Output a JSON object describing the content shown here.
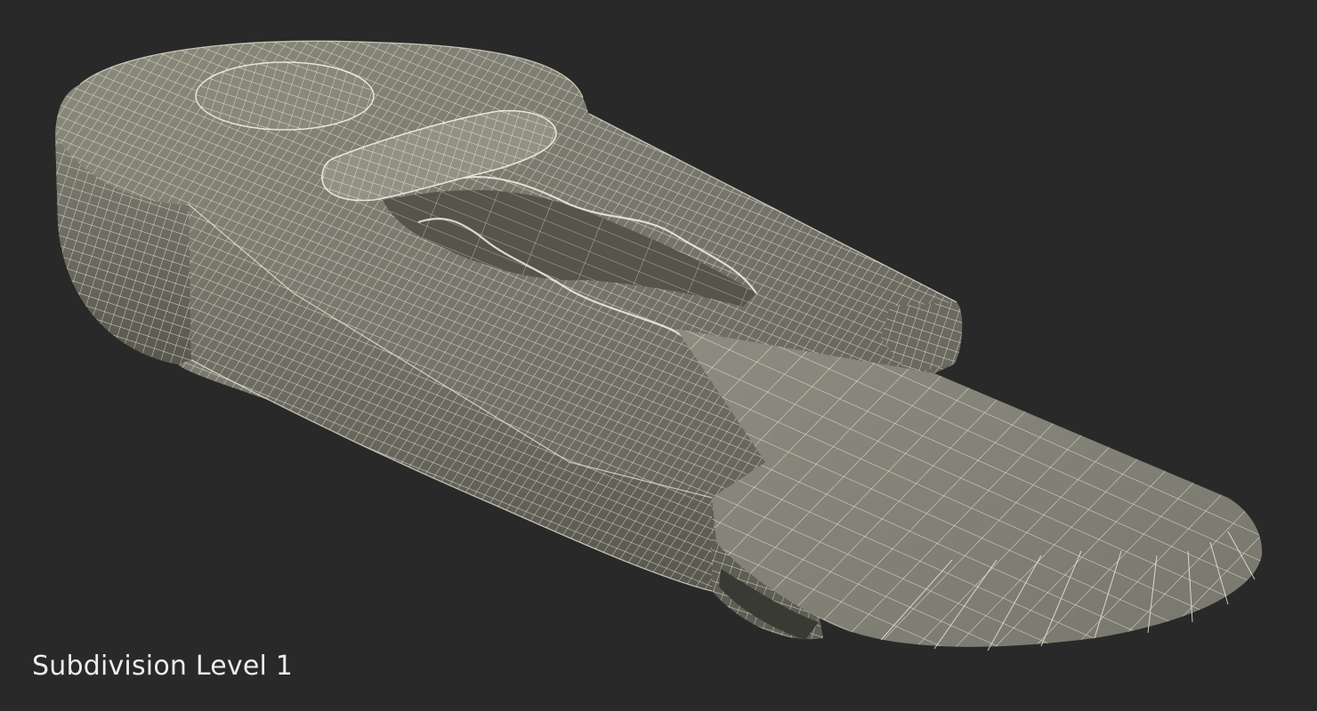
{
  "caption": "Subdivision Level 1",
  "colors": {
    "background": "#292929",
    "mesh_fill": "#78786c",
    "mesh_fill_light": "#8e8e80",
    "mesh_fill_dark": "#5e5e54",
    "wire": "#f3f0e0"
  },
  "model": {
    "name": "utility-knife-wireframe",
    "render_style": "wireframe-on-shaded"
  }
}
